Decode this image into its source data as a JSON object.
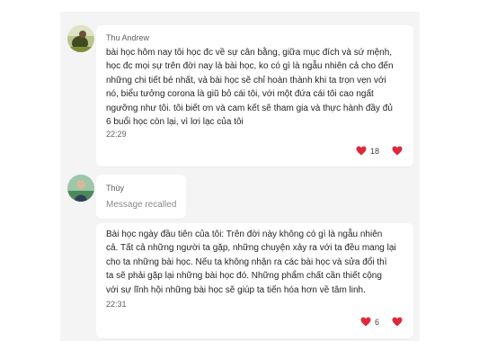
{
  "messages": [
    {
      "sender": "Thu Andrew",
      "text": "bài học hôm nay tôi học đc về sự cân bằng, giữa mục đích và sứ mệnh,\nhọc đc mọi sự trên đời nay là bài học, ko có gì là ngẫu nhiên cả cho đến\nnhững chi tiết bé nhất, và bài học sẽ chỉ hoàn thành khi ta trọn vẹn với\nnó, biểu tưởng corona là giũ bỏ cái tôi, với một đứa cái tôi cao ngất\nngưỡng như tôi. tôi biết ơn và cam kết sẽ tham gia và thực hành đầy đủ\n6 buổi học còn lại, vì lơi lạc của tôi",
      "time": "22:29",
      "reaction_count": "18"
    },
    {
      "sender": "Thùy",
      "recalled_text": "Message recalled"
    },
    {
      "text": "Bài học ngày đầu tiên của tôi: Trên đời này không có gì là ngẫu nhiên\ncả. Tất cả những người ta gặp, những chuyện xảy ra với ta đều mang lại\ncho ta những bài học. Nếu ta không nhận ra các bài học và sửa đổi thì\nta sẽ phải gặp lại những bài học đó. Những phẩm chất cần thiết cộng\nvới sự lĩnh hội những bài học sẽ giúp ta tiến hóa hơn về tâm linh.",
      "time": "22:31",
      "reaction_count": "6"
    }
  ],
  "colors": {
    "heart": "#e0283b",
    "background": "#f4f4f4",
    "bubble": "#ffffff"
  },
  "icons": [
    "heart-icon",
    "avatar-thu-andrew",
    "avatar-thuy"
  ]
}
